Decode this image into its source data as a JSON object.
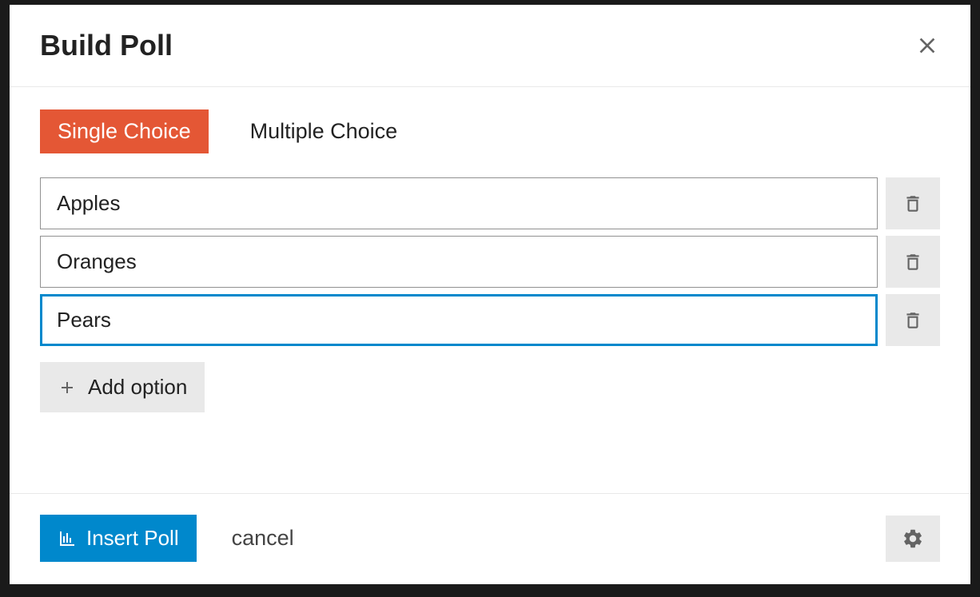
{
  "header": {
    "title": "Build Poll"
  },
  "tabs": {
    "single": "Single Choice",
    "multiple": "Multiple Choice",
    "active": "single"
  },
  "options": [
    {
      "value": "Apples",
      "focused": false
    },
    {
      "value": "Oranges",
      "focused": false
    },
    {
      "value": "Pears",
      "focused": true
    }
  ],
  "addOption": {
    "label": "Add option"
  },
  "footer": {
    "insert": "Insert Poll",
    "cancel": "cancel"
  }
}
